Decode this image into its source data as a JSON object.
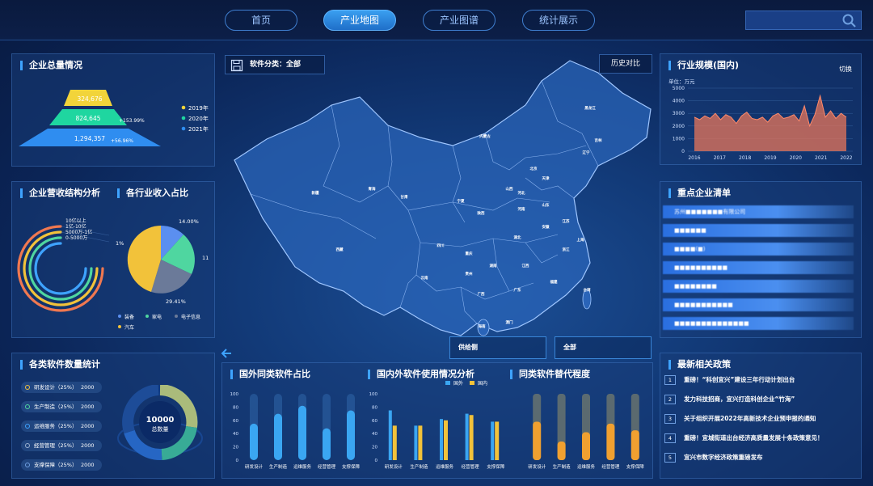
{
  "nav": {
    "items": [
      {
        "label": "首页",
        "active": false
      },
      {
        "label": "产业地图",
        "active": true
      },
      {
        "label": "产业图谱",
        "active": false
      },
      {
        "label": "统计展示",
        "active": false
      }
    ],
    "search_icon": "search-icon"
  },
  "enterprise_total": {
    "title": "企业总量情况",
    "levels": [
      {
        "value": "324,676",
        "growth": "",
        "color": "#f2d43a"
      },
      {
        "value": "824,645",
        "growth": "+153.99%",
        "color": "#1fd6a0"
      },
      {
        "value": "1,294,357",
        "growth": "+56.96%",
        "color": "#2f8df0"
      }
    ],
    "legend": [
      {
        "label": "2019年",
        "color": "#f2d43a"
      },
      {
        "label": "2020年",
        "color": "#1fd6a0"
      },
      {
        "label": "2021年",
        "color": "#2f8df0"
      }
    ]
  },
  "revenue_structure": {
    "title": "企业营收结构分析",
    "legend": [
      "10亿以上",
      "1亿-10亿",
      "5000万-1亿",
      "0-5000万"
    ]
  },
  "industry_income": {
    "title": "各行业收入占比",
    "labels": [
      "14.00%",
      "11",
      "29.41%",
      "1%"
    ],
    "legend": [
      {
        "label": "装备",
        "color": "#5b8ff0"
      },
      {
        "label": "家电",
        "color": "#4fd6a0"
      },
      {
        "label": "电子信息",
        "color": "#6b7a99"
      },
      {
        "label": "汽车",
        "color": "#f2c23a"
      }
    ]
  },
  "software_count": {
    "title": "各类软件数量统计",
    "items": [
      {
        "label": "研发设计（25%）",
        "value": "2000"
      },
      {
        "label": "生产制造（25%）",
        "value": "2000"
      },
      {
        "label": "运维服务（25%）",
        "value": "2000"
      },
      {
        "label": "经营管理（25%）",
        "value": "2000"
      },
      {
        "label": "支撑保障（25%）",
        "value": "2000"
      }
    ],
    "total_value": "10000",
    "total_label": "总数量"
  },
  "map": {
    "filter_label": "软件分类：全部",
    "history_label": "历史对比",
    "select_supply": "供给侧",
    "select_all": "全部",
    "arrow_icon": "left-arrow-icon",
    "provinces": [
      "新疆",
      "西藏",
      "青海",
      "甘肃",
      "内蒙古",
      "黑龙江",
      "吉林",
      "辽宁",
      "北京",
      "天津",
      "河北",
      "山西",
      "陕西",
      "宁夏",
      "河南",
      "山东",
      "江苏",
      "安徽",
      "湖北",
      "四川",
      "重庆",
      "贵州",
      "云南",
      "湖南",
      "江西",
      "浙江",
      "上海",
      "福建",
      "广东",
      "广西",
      "海南",
      "台湾",
      "澳门"
    ]
  },
  "industry_scale": {
    "title": "行业规模(国内)",
    "switch_label": "切换",
    "unit": "单位：万元"
  },
  "key_companies": {
    "title": "重点企业清单",
    "items": [
      "苏州■■■■■■■有限公司",
      "■■■■■■",
      "■■■■(■)",
      "■■■■■■■■■■",
      "■■■■■■■■",
      "■■■■■■■■■■■",
      "■■■■■■■■■■■■■■"
    ]
  },
  "policies": {
    "title": "最新相关政策",
    "items": [
      {
        "num": "1",
        "text": "重磅！“科创宜兴”建设三年行动计划出台"
      },
      {
        "num": "2",
        "text": "发力科技招商，宜兴打造科创企业“竹海”"
      },
      {
        "num": "3",
        "text": "关于组织开展2022年高新技术企业预申报的通知"
      },
      {
        "num": "4",
        "text": "重磅！宜城街道出台经济高质量发展十条政策意见！"
      },
      {
        "num": "5",
        "text": "宜兴市数字经济政策重磅发布"
      }
    ]
  },
  "chart_data": [
    {
      "type": "line",
      "title": "行业规模(国内)",
      "ylabel": "单位：万元",
      "x": [
        "2016",
        "2017",
        "2018",
        "2019",
        "2020",
        "2021",
        "2022"
      ],
      "ylim": [
        0,
        5000
      ],
      "yticks": [
        0,
        1000,
        2000,
        3000,
        4000,
        5000
      ],
      "series": [
        {
          "values": [
            2700,
            2500,
            2800,
            2600,
            3000,
            2500,
            2900,
            2700,
            2200,
            2800,
            3100,
            2600,
            2500,
            2700,
            2300,
            2800,
            3000,
            2600,
            2700,
            2900,
            2400,
            3600,
            2000,
            2900,
            4400,
            2700,
            3200,
            2600,
            3000,
            2700
          ]
        }
      ]
    },
    {
      "type": "bar",
      "title": "国外同类软件占比",
      "categories": [
        "研发设计",
        "生产制造",
        "运维服务",
        "经营管理",
        "支撑保障"
      ],
      "ylim": [
        0,
        100
      ],
      "yticks": [
        0,
        20,
        40,
        60,
        80,
        100
      ],
      "values": [
        55,
        70,
        82,
        48,
        75
      ]
    },
    {
      "type": "bar",
      "title": "国内外软件使用情况分析",
      "categories": [
        "研发设计",
        "生产制造",
        "运维服务",
        "经营管理",
        "支撑保障"
      ],
      "ylim": [
        0,
        100
      ],
      "yticks": [
        0,
        20,
        40,
        60,
        80,
        100
      ],
      "series": [
        {
          "name": "国外",
          "values": [
            75,
            52,
            62,
            70,
            58
          ]
        },
        {
          "name": "国内",
          "values": [
            52,
            52,
            60,
            68,
            58
          ]
        }
      ]
    },
    {
      "type": "bar",
      "title": "同类软件替代程度",
      "categories": [
        "研发设计",
        "生产制造",
        "运维服务",
        "经营管理",
        "支撑保障"
      ],
      "ylim": [
        0,
        100
      ],
      "values": [
        58,
        28,
        42,
        55,
        45
      ]
    }
  ]
}
